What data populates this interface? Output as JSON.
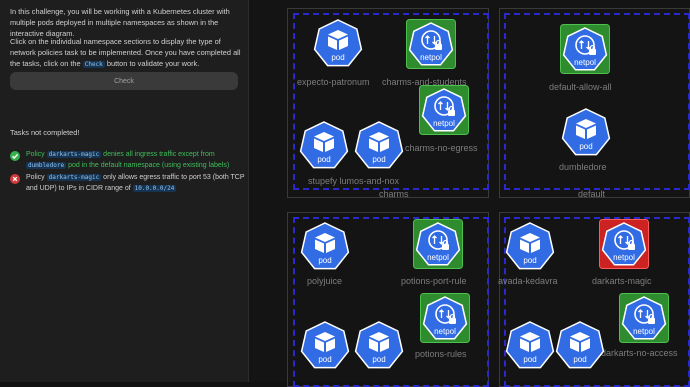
{
  "left_panel": {
    "intro_1": "In this challenge, you will be working with a Kubernetes cluster with multiple pods deployed in multiple namespaces as shown in the interactive diagram.",
    "intro_2_pre": "Click on the individual namespace sections to display the type of network policies task to be implemented. Once you have completed all the tasks, click on the",
    "intro_2_code": "Check",
    "intro_2_post": "button to validate your work.",
    "check_button": "Check",
    "status": "Tasks not completed!",
    "task1": {
      "pre": "Policy",
      "code1": "darkarts-magic",
      "mid": "denies all ingress traffic except from",
      "code2": "dumbledore",
      "post": "pod in the default namespace (using existing labels)"
    },
    "task2": {
      "pre": "Policy",
      "code1": "darkarts-magic",
      "mid": "only allows egress traffic to port 53 (both TCP and UDP) to IPs in CIDR range of",
      "code2": "10.0.0.0/24"
    }
  },
  "diagram": {
    "icon_pod": "pod",
    "icon_netpol": "netpol",
    "pod_color": "#326ce5",
    "netpol_green": "#2e8b2e",
    "netpol_red": "#cc2222",
    "namespaces": {
      "charms": "charms",
      "default": "default"
    },
    "labels": {
      "expecto_patronum": "expecto-patronum",
      "charms_and_students": "charms-and-students",
      "charms_no_egress": "charms-no-egress",
      "stupefy_lumos_nox": "stupefy lumos-and-nox",
      "default_allow_all": "default-allow-all",
      "dumbledore": "dumbledore",
      "polyjuice": "polyjuice",
      "potions_port_rule": "potions-port-rule",
      "potions_rules": "potions-rules",
      "avada_kedavra": "avada-kedavra",
      "darkarts_magic": "darkarts-magic",
      "darkarts_no_access": "darkarts-no-access"
    }
  }
}
